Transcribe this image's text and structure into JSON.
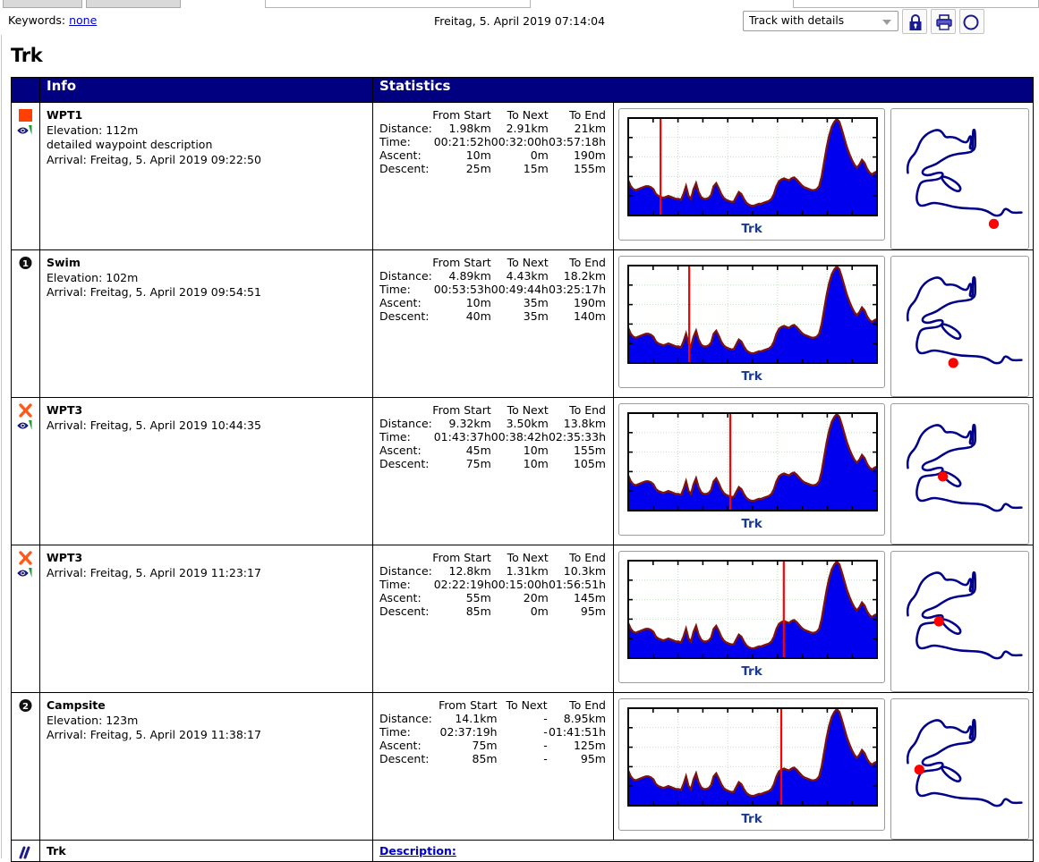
{
  "toolbar": {
    "keywords_label": "Keywords:",
    "keywords_value": "none",
    "date": "Freitag, 5. April 2019 07:14:04",
    "view_select": "Track with details",
    "lock_icon": "lock-icon",
    "print_icon": "printer-icon",
    "extra_icon": "printer-icon"
  },
  "page": {
    "title": "Trk"
  },
  "table": {
    "headers": {
      "icon": "",
      "info": "Info",
      "statistics": "Statistics",
      "charts": ""
    },
    "stat_columns": [
      "From Start",
      "To Next",
      "To End"
    ],
    "stat_rows": [
      "Distance:",
      "Time:",
      "Ascent:",
      "Descent:"
    ],
    "rows": [
      {
        "icon": "orange-square-icon",
        "secondary_icon": "eye-icon",
        "name": "WPT1",
        "elevation": "Elevation: 112m",
        "description": "detailed waypoint description",
        "arrival": "Arrival: Freitag, 5. April 2019 09:22:50",
        "stats": {
          "distance": [
            "1.98km",
            "2.91km",
            "21km"
          ],
          "time": [
            "00:21:52h",
            "00:32:00h",
            "03:57:18h"
          ],
          "ascent": [
            "10m",
            "0m",
            "190m"
          ],
          "descent": [
            "25m",
            "15m",
            "155m"
          ]
        },
        "chart_label": "Trk",
        "marker_fraction": 0.13,
        "map_marker": [
          0.75,
          0.845
        ]
      },
      {
        "icon": "numbered-circle-1-icon",
        "secondary_icon": "",
        "name": "Swim",
        "elevation": "Elevation: 102m",
        "description": "",
        "arrival": "Arrival: Freitag, 5. April 2019 09:54:51",
        "stats": {
          "distance": [
            "4.89km",
            "4.43km",
            "18.2km"
          ],
          "time": [
            "00:53:53h",
            "00:49:44h",
            "03:25:17h"
          ],
          "ascent": [
            "10m",
            "35m",
            "190m"
          ],
          "descent": [
            "40m",
            "35m",
            "140m"
          ]
        },
        "chart_label": "Trk",
        "marker_fraction": 0.245,
        "map_marker": [
          0.44,
          0.78
        ]
      },
      {
        "icon": "orange-cross-icon",
        "secondary_icon": "eye-icon",
        "name": "WPT3",
        "elevation": "",
        "description": "",
        "arrival": "Arrival: Freitag, 5. April 2019 10:44:35",
        "stats": {
          "distance": [
            "9.32km",
            "3.50km",
            "13.8km"
          ],
          "time": [
            "01:43:37h",
            "00:38:42h",
            "02:35:33h"
          ],
          "ascent": [
            "45m",
            "10m",
            "155m"
          ],
          "descent": [
            "75m",
            "10m",
            "105m"
          ]
        },
        "chart_label": "Trk",
        "marker_fraction": 0.41,
        "map_marker": [
          0.36,
          0.52
        ]
      },
      {
        "icon": "orange-cross-icon",
        "secondary_icon": "eye-icon",
        "name": "WPT3",
        "elevation": "",
        "description": "",
        "arrival": "Arrival: Freitag, 5. April 2019 11:23:17",
        "stats": {
          "distance": [
            "12.8km",
            "1.31km",
            "10.3km"
          ],
          "time": [
            "02:22:19h",
            "00:15:00h",
            "01:56:51h"
          ],
          "ascent": [
            "55m",
            "20m",
            "145m"
          ],
          "descent": [
            "85m",
            "0m",
            "95m"
          ]
        },
        "chart_label": "Trk",
        "marker_fraction": 0.625,
        "map_marker": [
          0.33,
          0.5
        ]
      },
      {
        "icon": "numbered-circle-2-icon",
        "secondary_icon": "",
        "name": "Campsite",
        "elevation": "Elevation: 123m",
        "description": "",
        "arrival": "Arrival: Freitag, 5. April 2019 11:38:17",
        "stats": {
          "distance": [
            "14.1km",
            "-",
            "8.95km"
          ],
          "time": [
            "02:37:19h",
            "-",
            "01:41:51h"
          ],
          "ascent": [
            "75m",
            "-",
            "125m"
          ],
          "descent": [
            "85m",
            "-",
            "95m"
          ]
        },
        "chart_label": "Trk",
        "marker_fraction": 0.615,
        "map_marker": [
          0.18,
          0.505
        ]
      }
    ],
    "footer_row": {
      "icon": "track-lines-icon",
      "name": "Trk",
      "description_label": "Description:"
    }
  },
  "colors": {
    "header_bg": "#000080",
    "link": "#0000cc",
    "elevation_fill": "#0000ee",
    "elevation_line": "#7b1410",
    "marker": "#ff0000",
    "track": "#00008b",
    "waypoint_orange": "#ff4000",
    "grid": "#bfe0bf"
  },
  "chart_data": {
    "type": "area",
    "title": "Trk",
    "xlabel": "",
    "ylabel": "",
    "grid": true,
    "note": "Track elevation profile, repeated per waypoint row with a red vertical position marker",
    "x": [
      0,
      1,
      2,
      3,
      4,
      5,
      6,
      7,
      8,
      9,
      10,
      11,
      12,
      13,
      14,
      15,
      16,
      17,
      18,
      19,
      20,
      21,
      22,
      23,
      24,
      25,
      26,
      27,
      28,
      29,
      30,
      31,
      32,
      33,
      34,
      35,
      36,
      37,
      38,
      39,
      40,
      41,
      42,
      43,
      44,
      45,
      46,
      47,
      48,
      49,
      50,
      51,
      52,
      53,
      54,
      55,
      56,
      57,
      58,
      59,
      60,
      61,
      62,
      63,
      64,
      65,
      66,
      67,
      68,
      69,
      70,
      71,
      72,
      73,
      74,
      75,
      76,
      77,
      78,
      79,
      80,
      81,
      82,
      83,
      84,
      85,
      86,
      87,
      88,
      89,
      90,
      91,
      92,
      93,
      94,
      95,
      96,
      97,
      98,
      99
    ],
    "values": [
      36,
      30,
      27,
      26,
      27,
      28,
      29,
      30,
      30,
      29,
      27,
      22,
      20,
      19,
      18,
      19,
      20,
      19,
      18,
      17,
      17,
      16,
      22,
      30,
      20,
      17,
      27,
      33,
      24,
      19,
      17,
      17,
      18,
      21,
      30,
      33,
      28,
      22,
      18,
      16,
      15,
      14,
      14,
      19,
      24,
      22,
      17,
      13,
      11,
      10,
      10,
      11,
      12,
      12,
      13,
      14,
      15,
      17,
      22,
      30,
      35,
      37,
      38,
      37,
      36,
      38,
      39,
      37,
      34,
      31,
      29,
      28,
      27,
      26,
      26,
      27,
      30,
      40,
      55,
      70,
      82,
      91,
      96,
      99,
      96,
      88,
      79,
      70,
      63,
      57,
      52,
      49,
      52,
      57,
      54,
      48,
      44,
      42,
      44,
      45
    ],
    "ylim": [
      0,
      100
    ],
    "marker_fractions": [
      0.13,
      0.245,
      0.41,
      0.625,
      0.615
    ]
  }
}
